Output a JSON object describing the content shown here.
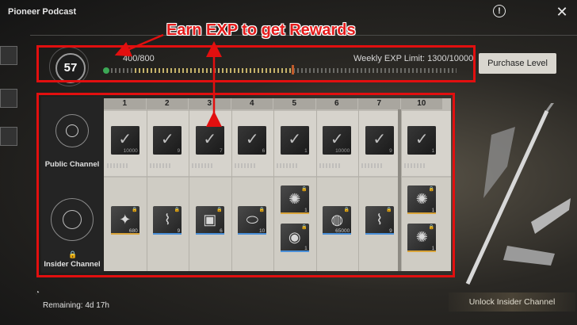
{
  "app": {
    "title": "Pioneer Podcast"
  },
  "annotation": {
    "title": "Earn EXP to get Rewards"
  },
  "level": {
    "current": "57",
    "exp_text": "400/800",
    "exp_progress": 0.5,
    "weekly_text": "Weekly EXP Limit: 1300/10000",
    "purchase_label": "Purchase Level"
  },
  "channels": {
    "public_label": "Public Channel",
    "insider_label": "Insider Channel"
  },
  "columns": [
    {
      "level": "1",
      "public": {
        "icon": "check-icon",
        "qty": "10000"
      },
      "insider": [
        {
          "icon": "star-shard-icon",
          "qty": "680"
        }
      ]
    },
    {
      "level": "2",
      "public": {
        "icon": "check-icon",
        "qty": "9"
      },
      "insider": [
        {
          "icon": "tube-icon",
          "qty": "9"
        }
      ]
    },
    {
      "level": "3",
      "public": {
        "icon": "check-icon",
        "qty": "7"
      },
      "insider": [
        {
          "icon": "device-icon",
          "qty": "6"
        }
      ]
    },
    {
      "level": "4",
      "public": {
        "icon": "check-icon",
        "qty": "6"
      },
      "insider": [
        {
          "icon": "capsule-icon",
          "qty": "10"
        }
      ]
    },
    {
      "level": "5",
      "public": {
        "icon": "check-icon",
        "qty": "1"
      },
      "insider": [
        {
          "icon": "gold-orb-icon",
          "qty": "1"
        },
        {
          "icon": "blue-orb-icon",
          "qty": "1"
        }
      ]
    },
    {
      "level": "6",
      "public": {
        "icon": "check-icon",
        "qty": "10000"
      },
      "insider": [
        {
          "icon": "shell-coin-icon",
          "qty": "65000"
        }
      ]
    },
    {
      "level": "7",
      "public": {
        "icon": "check-icon",
        "qty": "9"
      },
      "insider": [
        {
          "icon": "tube-icon",
          "qty": "9"
        }
      ]
    },
    {
      "level": "10",
      "public": {
        "icon": "check-icon",
        "qty": "1"
      },
      "insider": [
        {
          "icon": "gold-orb-icon",
          "qty": "1"
        },
        {
          "icon": "gold-orb-icon",
          "qty": "1"
        }
      ]
    }
  ],
  "footer": {
    "remaining": "Remaining: 4d 17h",
    "unlock_label": "Unlock Insider Channel"
  },
  "colors": {
    "annotation_red": "#e41b1b",
    "exp_fill": "#d4be6a",
    "rarity_gold": "#d9a43a",
    "rarity_purple": "#9a5ad6",
    "rarity_blue": "#4a8fd8"
  }
}
